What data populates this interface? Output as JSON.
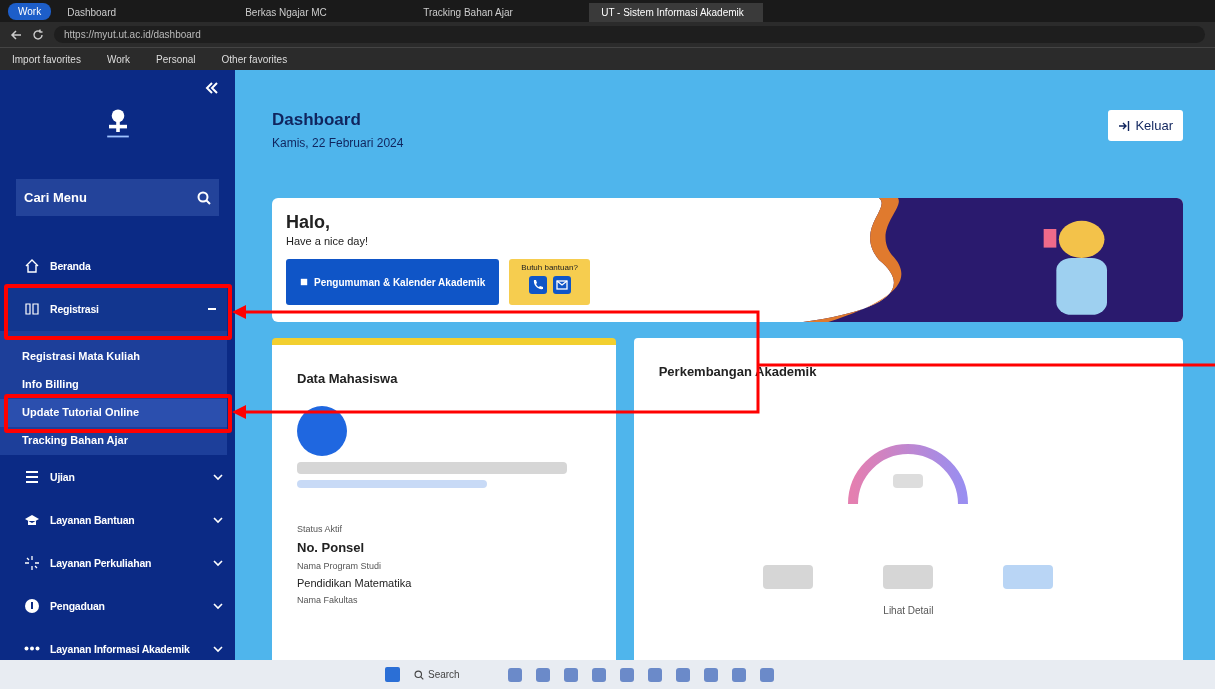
{
  "browser": {
    "profile": "Work",
    "tabs": [
      {
        "title": "Dashboard",
        "selected": false
      },
      {
        "title": "Berkas Ngajar MC",
        "selected": false
      },
      {
        "title": "Tracking Bahan Ajar",
        "selected": false
      },
      {
        "title": "UT - Sistem Informasi Akademik",
        "selected": true
      }
    ],
    "address": "https://myut.ut.ac.id/dashboard",
    "bookmarks": [
      "Import favorites",
      "Work",
      "Personal",
      "Other favorites"
    ]
  },
  "sidebar": {
    "search": {
      "placeholder": "Cari Menu"
    },
    "items": [
      {
        "label": "Beranda",
        "kind": "home",
        "selected": false
      },
      {
        "label": "Registrasi",
        "kind": "grid",
        "expanded": true,
        "selected": true,
        "children": [
          {
            "label": "Registrasi Mata Kuliah",
            "selected": false
          },
          {
            "label": "Info Billing",
            "selected": false
          },
          {
            "label": "Update Tutorial Online",
            "selected": true
          },
          {
            "label": "Tracking Bahan Ajar",
            "selected": false
          }
        ]
      },
      {
        "label": "Ujian",
        "kind": "list",
        "expanded": false,
        "selected": false
      },
      {
        "label": "Layanan Bantuan",
        "kind": "cap",
        "expanded": false,
        "selected": false
      },
      {
        "label": "Layanan Perkuliahan",
        "kind": "sparkle",
        "expanded": false,
        "selected": false
      },
      {
        "label": "Pengaduan",
        "kind": "info",
        "expanded": false,
        "selected": false
      },
      {
        "label": "Layanan Informasi Akademik",
        "kind": "dots",
        "expanded": false,
        "selected": false
      }
    ]
  },
  "header": {
    "title": "Dashboard",
    "date": "Kamis, 22 Februari 2024",
    "logout": "Keluar"
  },
  "welcome": {
    "greeting": "Halo,",
    "subtitle": "Have a nice day!",
    "announcement_button": "Pengumuman & Kalender Akademik",
    "help_label": "Butuh bantuan?"
  },
  "student_card": {
    "title": "Data Mahasiswa",
    "fields": [
      {
        "label": "Status Aktif",
        "value": "No. Ponsel"
      },
      {
        "label": "Nama Program Studi",
        "value": "Pendidikan Matematika"
      },
      {
        "label": "Nama Fakultas"
      }
    ]
  },
  "academic_card": {
    "title": "Perkembangan Akademik",
    "link": "Lihat Detail"
  },
  "taskbar": {
    "search": "Search"
  }
}
